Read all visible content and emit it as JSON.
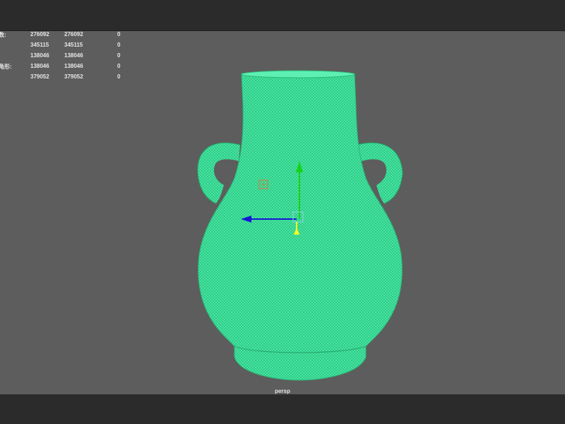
{
  "hud": {
    "rows": [
      {
        "label": "数:",
        "v1": "276092",
        "v2": "276092",
        "v3": "0"
      },
      {
        "label": "",
        "v1": "345115",
        "v2": "345115",
        "v3": "0"
      },
      {
        "label": "",
        "v1": "138046",
        "v2": "138046",
        "v3": "0"
      },
      {
        "label": "角形:",
        "v1": "138046",
        "v2": "138046",
        "v3": "0"
      },
      {
        "label": ":",
        "v1": "379052",
        "v2": "379052",
        "v3": "0"
      }
    ]
  },
  "viewport": {
    "camera": "persp",
    "background_color": "#5d5d5d",
    "mesh_color": "#3fe39c",
    "wire_color": "#1f9a63"
  },
  "manipulator": {
    "y_axis_color": "#16d316",
    "x_axis_color": "#1616d6",
    "center_color": "#ffff1a"
  },
  "icons": {
    "pivot": "pivot-marker-icon"
  }
}
